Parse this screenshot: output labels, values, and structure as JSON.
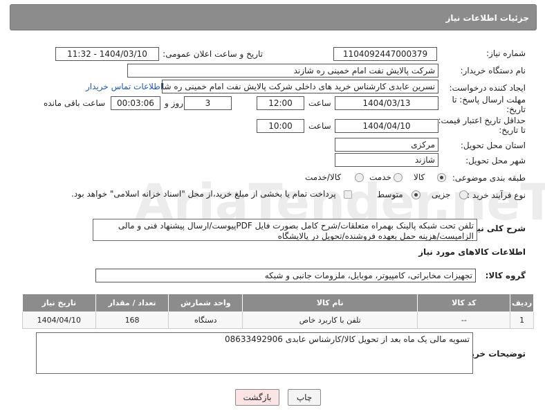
{
  "header": {
    "title": "جزئیات اطلاعات نیاز"
  },
  "need_number": {
    "label": "شماره نیاز:",
    "value": "1104092447000379"
  },
  "announce": {
    "label": "تاریخ و ساعت اعلان عمومی:",
    "value": "1404/03/10 - 11:32"
  },
  "buyer_org": {
    "label": "نام دستگاه خریدار:",
    "value": "شرکت پالایش نفت امام خمینی  ره  شازند"
  },
  "creator": {
    "label": "ایجاد کننده درخواست:",
    "value": "نسرین عابدی کارشناس خرید های داخلی  شرکت پالایش نفت امام خمینی  ره  شازند",
    "contact_link": "اطلاعات تماس خریدار"
  },
  "deadline": {
    "label_line1": "مهلت ارسال پاسخ: تا",
    "label_line2": "تاریخ:",
    "date": "1404/03/13",
    "time_label": "ساعت",
    "time": "12:00",
    "days": "3",
    "days_label": "روز و",
    "remaining": "00:03:06",
    "remaining_label": "ساعت باقی مانده"
  },
  "validity": {
    "label_line1": "حداقل تاریخ اعتبار قیمت:",
    "label_line2": "تا تاریخ:",
    "date": "1404/04/10",
    "time_label": "ساعت",
    "time": "10:00"
  },
  "province": {
    "label": "استان محل تحویل:",
    "value": "مرکزی"
  },
  "city": {
    "label": "شهر محل تحویل:",
    "value": "شازند"
  },
  "category": {
    "label": "طبقه بندی موضوعی:",
    "options": [
      "کالا",
      "خدمت",
      "کالا/خدمت"
    ],
    "selected": "کالا"
  },
  "process": {
    "label": "نوع فرآیند خرید :",
    "options": [
      "جزیی",
      "متوسط"
    ],
    "selected": "متوسط",
    "note": "پرداخت تمام یا بخشی از مبلغ خرید،از محل \"اسناد خزانه اسلامی\" خواهد بود."
  },
  "description": {
    "label": "شرح کلی نیاز:",
    "text": "تلفن تحت شبکه پالینک بهمراه متعلقات/شرح کامل بصورت فایل PDFپیوست/ارسال پیشنهاد فنی و مالی الزامیست/هزینه حمل بعهده فروشنده/تحویل در پالایشگاه"
  },
  "goods_info": {
    "title": "اطلاعات کالاهای مورد نیاز"
  },
  "goods_group": {
    "label": "گروه کالا:",
    "value": "تجهیزات مخابراتی، کامپیوتر، موبایل، ملزومات جانبی و شبکه"
  },
  "table": {
    "headers": [
      "ردیف",
      "کد کالا",
      "نام کالا",
      "واحد شمارش",
      "تعداد / مقدار",
      "تاریخ نیاز"
    ],
    "rows": [
      [
        "1",
        "--",
        "تلفن با کاربرد خاص",
        "دستگاه",
        "168",
        "1404/04/10"
      ]
    ]
  },
  "buyer_notes": {
    "label": "توضیحات خریدار:",
    "text": "تسویه مالی یک ماه بعد از تحویل کالا/کارشناس عابدی 08633492906"
  },
  "buttons": {
    "print": "چاپ",
    "back": "بازگشت"
  },
  "watermark": {
    "text": "AriaTender.neT"
  },
  "colors": {
    "header_bg": "#8c8c8c",
    "link": "#1a56c8",
    "back_button_bg": "#fde4e4"
  }
}
